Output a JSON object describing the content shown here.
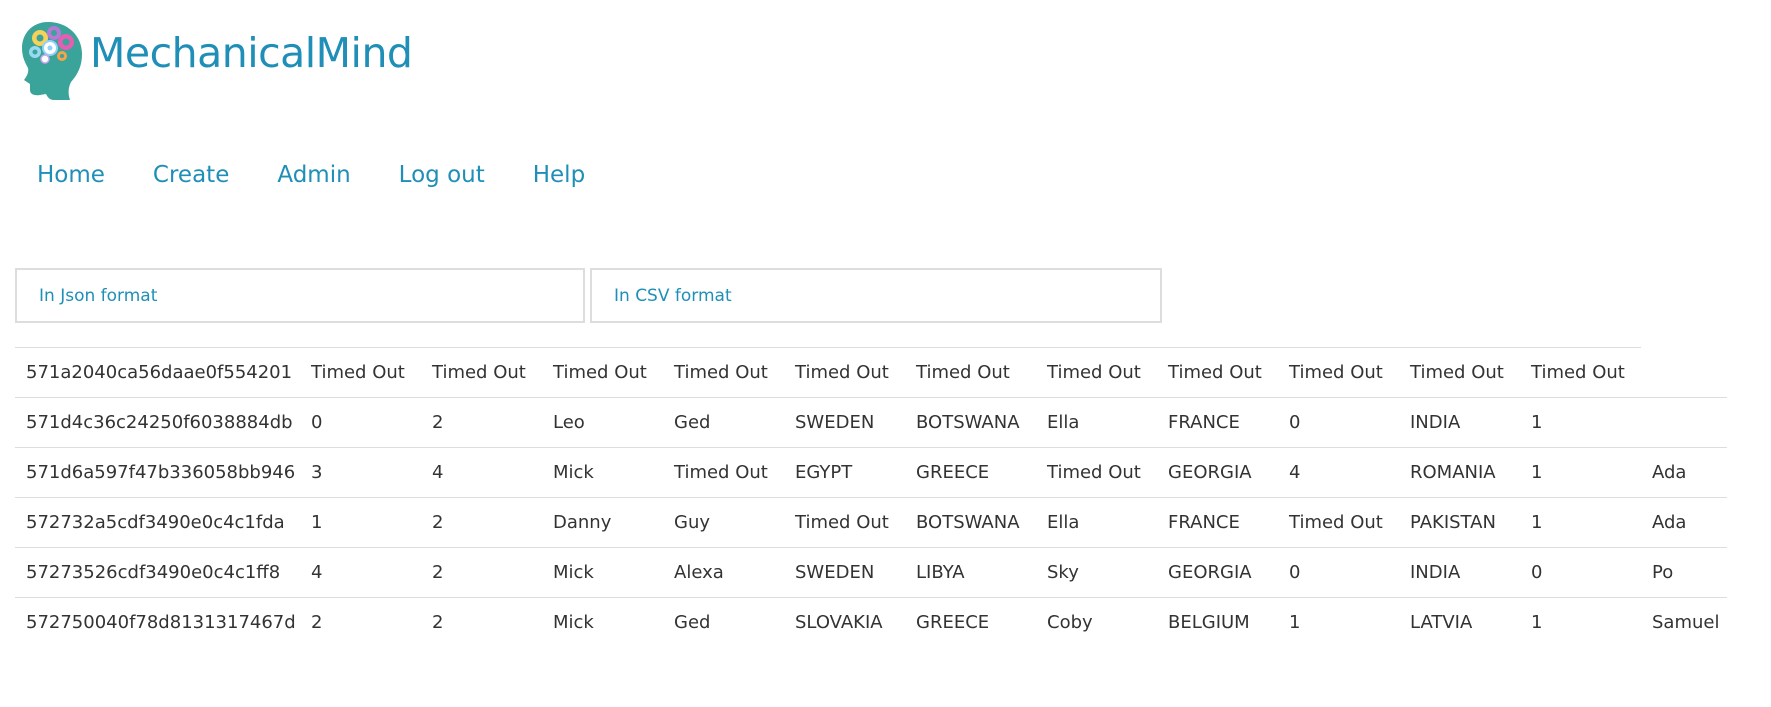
{
  "app": {
    "name": "MechanicalMind",
    "logo_icon": "brain-head-logo-icon"
  },
  "nav": {
    "items": [
      {
        "label": "Home"
      },
      {
        "label": "Create"
      },
      {
        "label": "Admin"
      },
      {
        "label": "Log out"
      },
      {
        "label": "Help"
      }
    ]
  },
  "exports": {
    "json_label": "In Json format",
    "csv_label": "In CSV format"
  },
  "results": {
    "rows": [
      [
        "571a2040ca56daae0f554201",
        "Timed Out",
        "Timed Out",
        "Timed Out",
        "Timed Out",
        "Timed Out",
        "Timed Out",
        "Timed Out",
        "Timed Out",
        "Timed Out",
        "Timed Out",
        "Timed Out",
        ""
      ],
      [
        "571d4c36c24250f6038884db",
        "0",
        "2",
        "Leo",
        "Ged",
        "SWEDEN",
        "BOTSWANA",
        "Ella",
        "FRANCE",
        "0",
        "INDIA",
        "1",
        ""
      ],
      [
        "571d6a597f47b336058bb946",
        "3",
        "4",
        "Mick",
        "Timed Out",
        "EGYPT",
        "GREECE",
        "Timed Out",
        "GEORGIA",
        "4",
        "ROMANIA",
        "1",
        "Ada"
      ],
      [
        "572732a5cdf3490e0c4c1fda",
        "1",
        "2",
        "Danny",
        "Guy",
        "Timed Out",
        "BOTSWANA",
        "Ella",
        "FRANCE",
        "Timed Out",
        "PAKISTAN",
        "1",
        "Ada"
      ],
      [
        "57273526cdf3490e0c4c1ff8",
        "4",
        "2",
        "Mick",
        "Alexa",
        "SWEDEN",
        "LIBYA",
        "Sky",
        "GEORGIA",
        "0",
        "INDIA",
        "0",
        "Po"
      ],
      [
        "572750040f78d8131317467d",
        "2",
        "2",
        "Mick",
        "Ged",
        "SLOVAKIA",
        "GREECE",
        "Coby",
        "BELGIUM",
        "1",
        "LATVIA",
        "1",
        "Samuel"
      ]
    ]
  },
  "colors": {
    "link": "#1f8fb8",
    "head": "#3aa39a",
    "border": "#dddddd",
    "text": "#333333"
  }
}
